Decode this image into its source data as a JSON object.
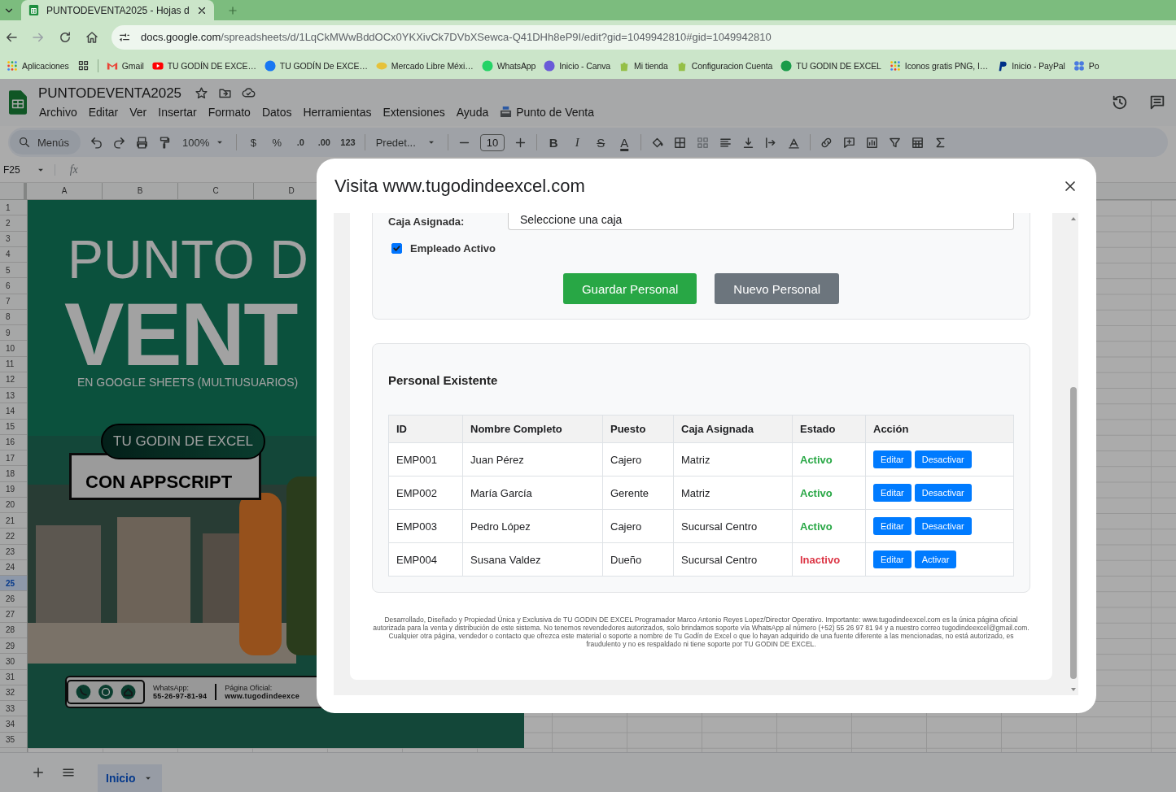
{
  "browser": {
    "tab": {
      "title": "PUNTODEVENTA2025 - Hojas d",
      "selected": true
    },
    "address": {
      "host": "docs.google.com",
      "path": "/spreadsheets/d/1LqCkMWwBddOCx0YKXivCk7DVbXSewca-Q41DHh8eP9I/edit?gid=1049942810#gid=1049942810"
    },
    "bookmarks": [
      "Aplicaciones",
      "Gmail",
      "TU GODÍN DE EXCE…",
      "TU GODÍN De EXCE…",
      "Mercado Libre Méxi…",
      "WhatsApp",
      "Inicio - Canva",
      "Mi tienda",
      "Configuracion Cuenta",
      "TU GODIN DE EXCEL",
      "Iconos gratis PNG, I…",
      "Inicio - PayPal",
      "Po"
    ]
  },
  "sheets": {
    "title": "PUNTODEVENTA2025",
    "menu": [
      "Archivo",
      "Editar",
      "Ver",
      "Insertar",
      "Formato",
      "Datos",
      "Herramientas",
      "Extensiones",
      "Ayuda",
      "Punto de Venta"
    ],
    "toolbar": {
      "search_placeholder": "Menús",
      "zoom": "100%",
      "number_buttons": [
        "$",
        "%",
        ".0",
        ".00",
        "123"
      ],
      "font": "Predet...",
      "font_size": "10",
      "style_buttons": [
        "B",
        "I",
        "S",
        "A"
      ]
    },
    "cell_ref": "F25",
    "fx": "fx",
    "columns": [
      "A",
      "B",
      "C",
      "D"
    ],
    "rows": [
      {
        "label": "1",
        "selected": false
      },
      {
        "label": "2",
        "selected": false
      },
      {
        "label": "3",
        "selected": false
      },
      {
        "label": "4",
        "selected": false
      },
      {
        "label": "5",
        "selected": false
      },
      {
        "label": "6",
        "selected": false
      },
      {
        "label": "7",
        "selected": false
      },
      {
        "label": "8",
        "selected": false
      },
      {
        "label": "9",
        "selected": false
      },
      {
        "label": "10",
        "selected": false
      },
      {
        "label": "11",
        "selected": false
      },
      {
        "label": "12",
        "selected": false
      },
      {
        "label": "13",
        "selected": false
      },
      {
        "label": "14",
        "selected": false
      },
      {
        "label": "15",
        "selected": false
      },
      {
        "label": "16",
        "selected": false
      },
      {
        "label": "17",
        "selected": false
      },
      {
        "label": "18",
        "selected": false
      },
      {
        "label": "19",
        "selected": false
      },
      {
        "label": "20",
        "selected": false
      },
      {
        "label": "21",
        "selected": false
      },
      {
        "label": "22",
        "selected": false
      },
      {
        "label": "23",
        "selected": false
      },
      {
        "label": "24",
        "selected": false
      },
      {
        "label": "25",
        "selected": true
      },
      {
        "label": "26",
        "selected": false
      },
      {
        "label": "27",
        "selected": false
      },
      {
        "label": "28",
        "selected": false
      },
      {
        "label": "29",
        "selected": false
      },
      {
        "label": "30",
        "selected": false
      },
      {
        "label": "31",
        "selected": false
      },
      {
        "label": "32",
        "selected": false
      },
      {
        "label": "33",
        "selected": false
      },
      {
        "label": "34",
        "selected": false
      },
      {
        "label": "35",
        "selected": false
      }
    ],
    "poster": {
      "headline": "PUNTO D",
      "headline_big": "VENT",
      "subtitle": "EN GOOGLE SHEETS (MULTIUSUARIOS)",
      "badge": "TU GODIN DE EXCEL",
      "banner": "CON APPSCRIPT",
      "whatsapp_label": "WhatsApp:",
      "whatsapp_number": "55-26-97-81-94",
      "site_label": "Página Oficial:",
      "site_url": "www.tugodindeexce"
    },
    "sheet_tabs": [
      {
        "label": "Inicio",
        "selected": true
      }
    ]
  },
  "modal": {
    "title": "Visita www.tugodindeexcel.com",
    "form": {
      "field_label": "Caja Asignada:",
      "select_placeholder": "Seleccione una caja",
      "active_checkbox": {
        "label": "Empleado Activo",
        "checked": true
      },
      "buttons": [
        {
          "label": "Guardar Personal",
          "kind": "primary"
        },
        {
          "label": "Nuevo Personal",
          "kind": "secondary"
        }
      ]
    },
    "staff": {
      "title": "Personal Existente",
      "columns": [
        "ID",
        "Nombre Completo",
        "Puesto",
        "Caja Asignada",
        "Estado",
        "Acción"
      ],
      "rows": [
        {
          "id": "EMP001",
          "name": "Juan Pérez",
          "role": "Cajero",
          "box": "Matriz",
          "status": {
            "label": "Activo",
            "kind": "active"
          },
          "actions": [
            "Editar",
            "Desactivar"
          ]
        },
        {
          "id": "EMP002",
          "name": "María García",
          "role": "Gerente",
          "box": "Matriz",
          "status": {
            "label": "Activo",
            "kind": "active"
          },
          "actions": [
            "Editar",
            "Desactivar"
          ]
        },
        {
          "id": "EMP003",
          "name": "Pedro López",
          "role": "Cajero",
          "box": "Sucursal Centro",
          "status": {
            "label": "Activo",
            "kind": "active"
          },
          "actions": [
            "Editar",
            "Desactivar"
          ]
        },
        {
          "id": "EMP004",
          "name": "Susana Valdez",
          "role": "Dueño",
          "box": "Sucursal Centro",
          "status": {
            "label": "Inactivo",
            "kind": "inactive"
          },
          "actions": [
            "Editar",
            "Activar"
          ]
        }
      ]
    },
    "footer": "Desarrollado, Diseñado y Propiedad Única y Exclusiva de TU GODIN DE EXCEL Programador Marco Antonio Reyes Lopez/Director Operativo. Importante: www.tugodindeexcel.com es la única página oficial autorizada para la venta y distribución de este sistema. No tenemos revendedores autorizados, solo brindamos soporte vía WhatsApp al número (+52) 55 26 97 81 94 y a nuestro correo tugodindeexcel@gmail.com. Cualquier otra página, vendedor o contacto que ofrezca este material o soporte a nombre de Tu Godín de Excel o que lo hayan adquirido de una fuente diferente a las mencionadas, no está autorizado, es fraudulento y no es respaldado ni tiene soporte por TU GODIN DE EXCEL."
  }
}
